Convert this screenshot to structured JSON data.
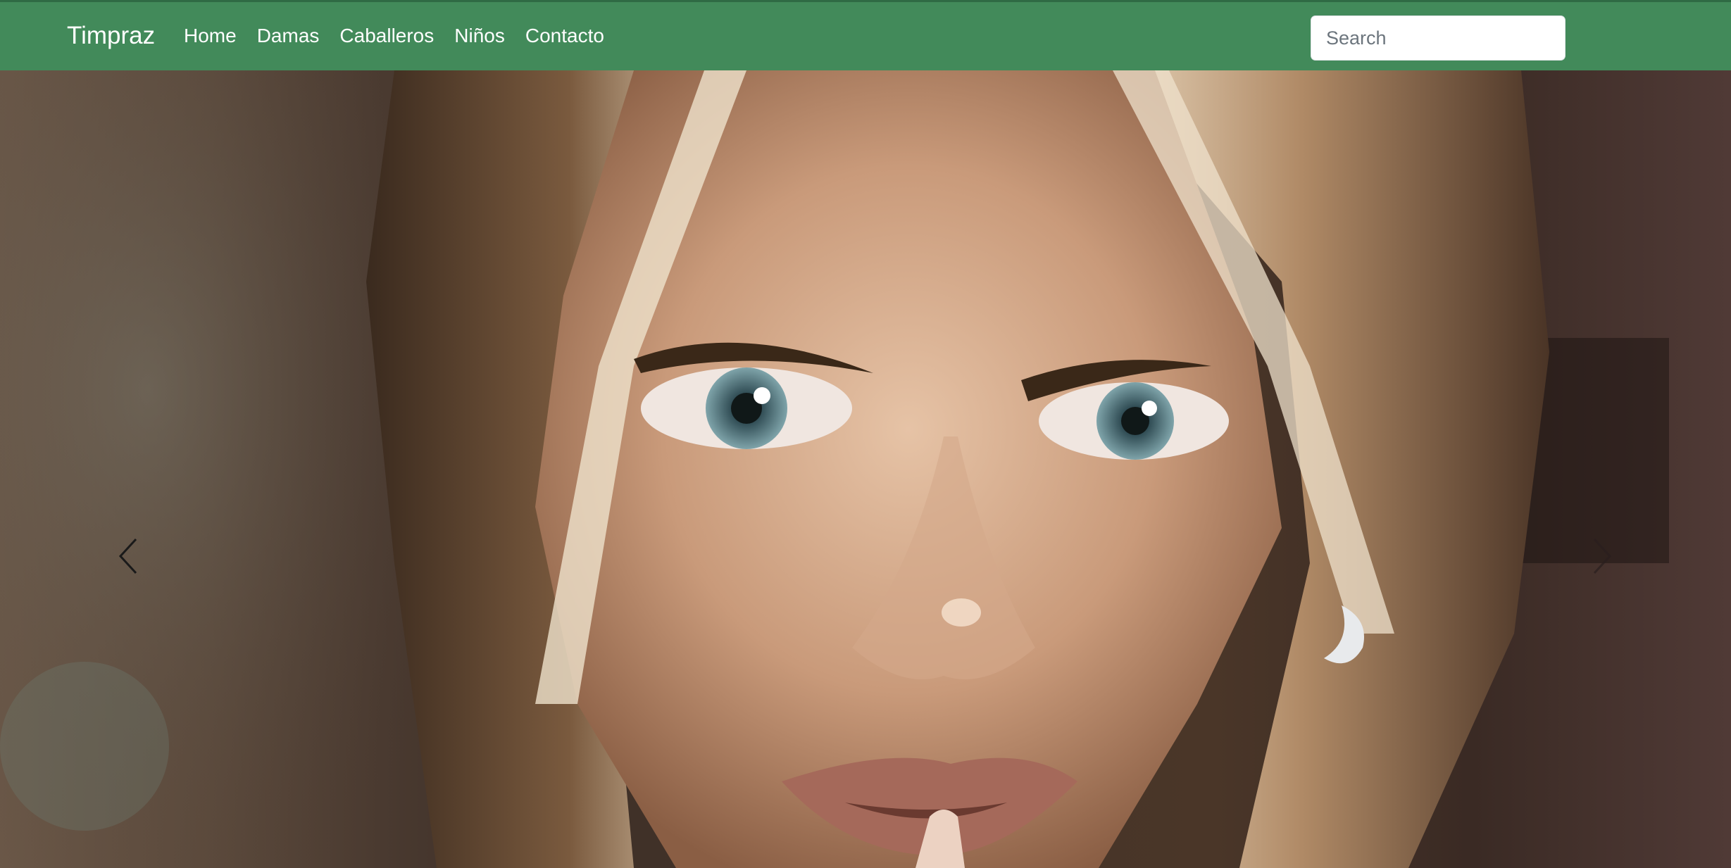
{
  "navbar": {
    "brand": "Timpraz",
    "links": [
      {
        "label": "Home"
      },
      {
        "label": "Damas"
      },
      {
        "label": "Caballeros"
      },
      {
        "label": "Niños"
      },
      {
        "label": "Contacto"
      }
    ],
    "search": {
      "placeholder": "Search",
      "value": ""
    }
  },
  "carousel": {
    "prev_icon": "chevron-left-icon",
    "next_icon": "chevron-right-icon",
    "slide_image": "portrait-woman-illustration"
  },
  "colors": {
    "navbar_bg": "#428a5a",
    "nav_text": "#ffffff"
  }
}
